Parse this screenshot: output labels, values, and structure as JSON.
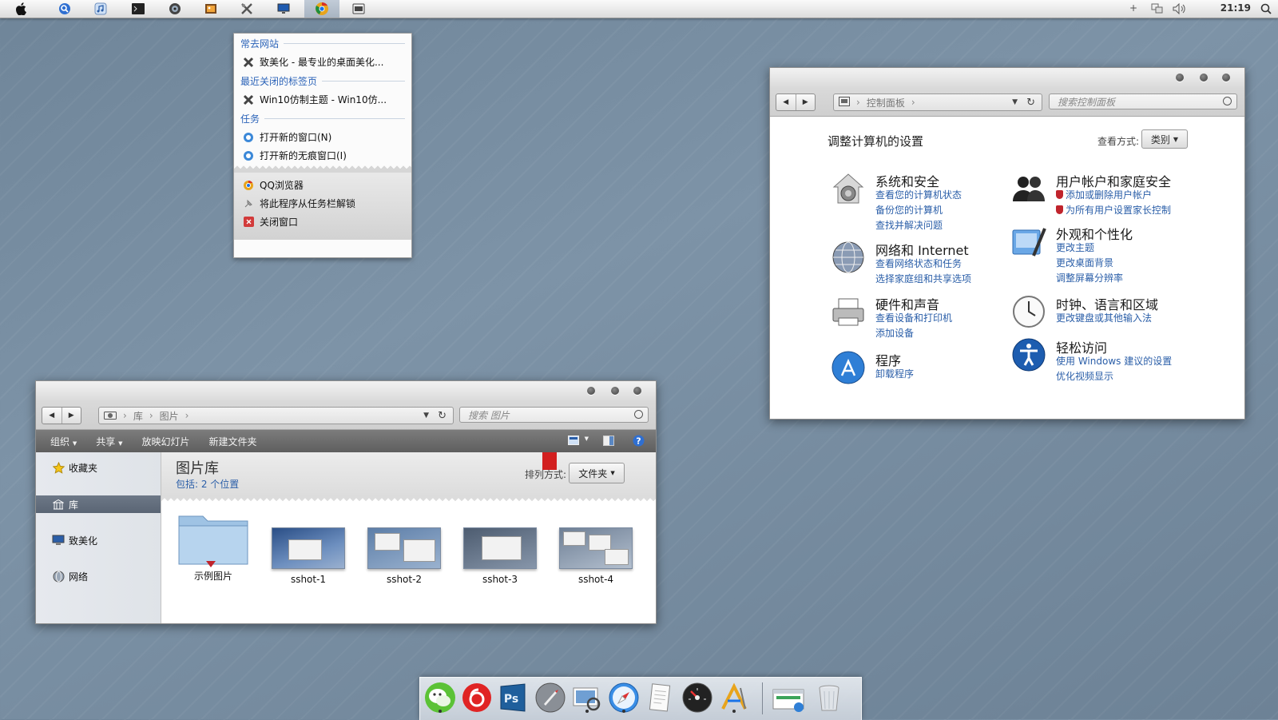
{
  "menubar": {
    "apps": [
      "apple",
      "search",
      "itunes",
      "terminal",
      "disk",
      "photo",
      "tools",
      "monitor",
      "chrome",
      "control-panel"
    ],
    "active": "chrome",
    "time": "21:19"
  },
  "jumplist": {
    "frequent_header": "常去网站",
    "frequent_item": "致美化 - 最专业的桌面美化...",
    "recent_header": "最近关闭的标签页",
    "recent_item": "Win10仿制主题 - Win10仿...",
    "tasks_header": "任务",
    "task_new": "打开新的窗口(N)",
    "task_incognito": "打开新的无痕窗口(I)",
    "app_name": "QQ浏览器",
    "unpin": "将此程序从任务栏解锁",
    "close": "关闭窗口"
  },
  "explorer": {
    "crumbs": [
      "库",
      "图片"
    ],
    "search_placeholder": "搜索 图片",
    "commands": {
      "organize": "组织",
      "share": "共享",
      "slideshow": "放映幻灯片",
      "new_folder": "新建文件夹"
    },
    "sidebar": {
      "favorites": "收藏夹",
      "libraries": "库",
      "computer": "致美化",
      "network": "网络"
    },
    "library_title": "图片库",
    "library_sub": "包括: 2 个位置",
    "arrange_label": "排列方式:",
    "arrange_value": "文件夹",
    "items": [
      "示例图片",
      "sshot-1",
      "sshot-2",
      "sshot-3",
      "sshot-4"
    ]
  },
  "control_panel": {
    "crumb": "控制面板",
    "search_placeholder": "搜索控制面板",
    "heading": "调整计算机的设置",
    "view_label": "查看方式:",
    "view_value": "类别",
    "categories": [
      {
        "title": "系统和安全",
        "links": [
          "查看您的计算机状态",
          "备份您的计算机",
          "查找并解决问题"
        ]
      },
      {
        "title": "网络和 Internet",
        "links": [
          "查看网络状态和任务",
          "选择家庭组和共享选项"
        ]
      },
      {
        "title": "硬件和声音",
        "links": [
          "查看设备和打印机",
          "添加设备"
        ]
      },
      {
        "title": "程序",
        "links": [
          "卸载程序"
        ]
      },
      {
        "title": "用户帐户和家庭安全",
        "links": [
          "添加或删除用户帐户",
          "为所有用户设置家长控制"
        ]
      },
      {
        "title": "外观和个性化",
        "links": [
          "更改主题",
          "更改桌面背景",
          "调整屏幕分辨率"
        ]
      },
      {
        "title": "时钟、语言和区域",
        "links": [
          "更改键盘或其他输入法"
        ]
      },
      {
        "title": "轻松访问",
        "links": [
          "使用 Windows 建议的设置",
          "优化视频显示"
        ]
      }
    ]
  },
  "dock": {
    "apps": [
      "wechat",
      "netease-music",
      "photoshop",
      "launchpad",
      "preview",
      "safari",
      "textedit",
      "dashboard",
      "app-store",
      "explorer",
      "trash"
    ]
  }
}
